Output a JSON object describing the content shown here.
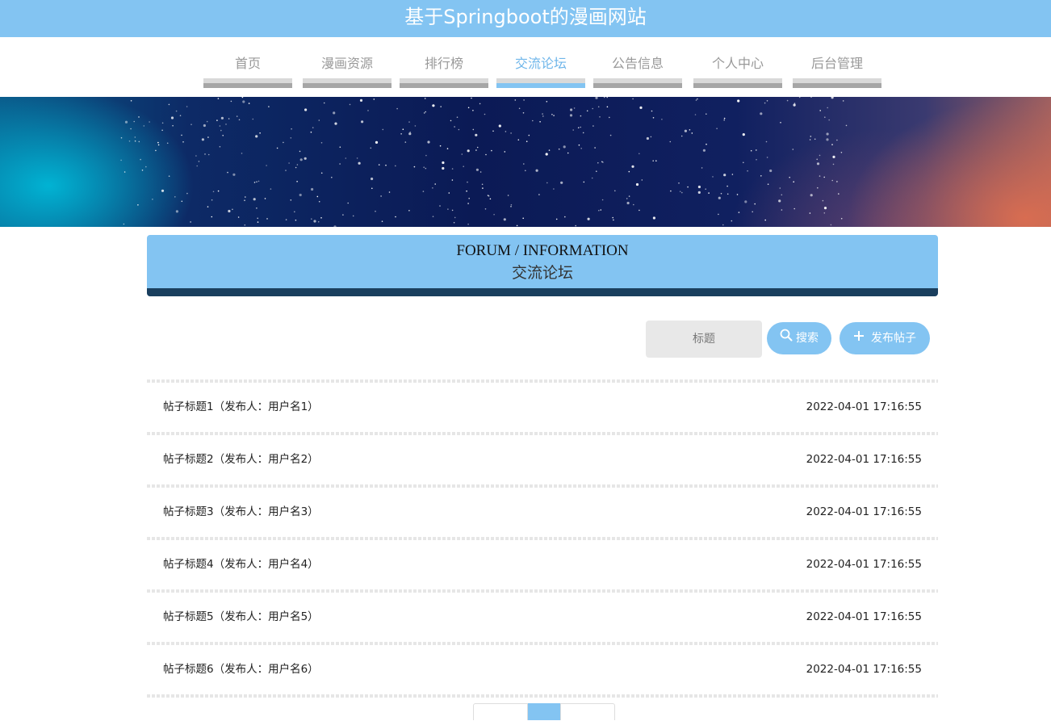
{
  "header": {
    "title": "基于Springboot的漫画网站"
  },
  "nav": {
    "items": [
      {
        "label": "首页"
      },
      {
        "label": "漫画资源"
      },
      {
        "label": "排行榜"
      },
      {
        "label": "交流论坛",
        "active": true
      },
      {
        "label": "公告信息"
      },
      {
        "label": "个人中心"
      },
      {
        "label": "后台管理"
      }
    ]
  },
  "section": {
    "title_en": "FORUM / INFORMATION",
    "title_zh": "交流论坛"
  },
  "search": {
    "placeholder": "标题",
    "search_label": "搜索",
    "post_label": "发布帖子"
  },
  "posts": [
    {
      "title": "帖子标题1（发布人：用户名1）",
      "time": "2022-04-01 17:16:55"
    },
    {
      "title": "帖子标题2（发布人：用户名2）",
      "time": "2022-04-01 17:16:55"
    },
    {
      "title": "帖子标题3（发布人：用户名3）",
      "time": "2022-04-01 17:16:55"
    },
    {
      "title": "帖子标题4（发布人：用户名4）",
      "time": "2022-04-01 17:16:55"
    },
    {
      "title": "帖子标题5（发布人：用户名5）",
      "time": "2022-04-01 17:16:55"
    },
    {
      "title": "帖子标题6（发布人：用户名6）",
      "time": "2022-04-01 17:16:55"
    }
  ],
  "colors": {
    "accent": "#83c4f2",
    "header_strip": "#1a3f5e",
    "nav_inactive": "#999999"
  },
  "icons": {
    "search": "magnifier-icon",
    "post": "plus-icon"
  }
}
